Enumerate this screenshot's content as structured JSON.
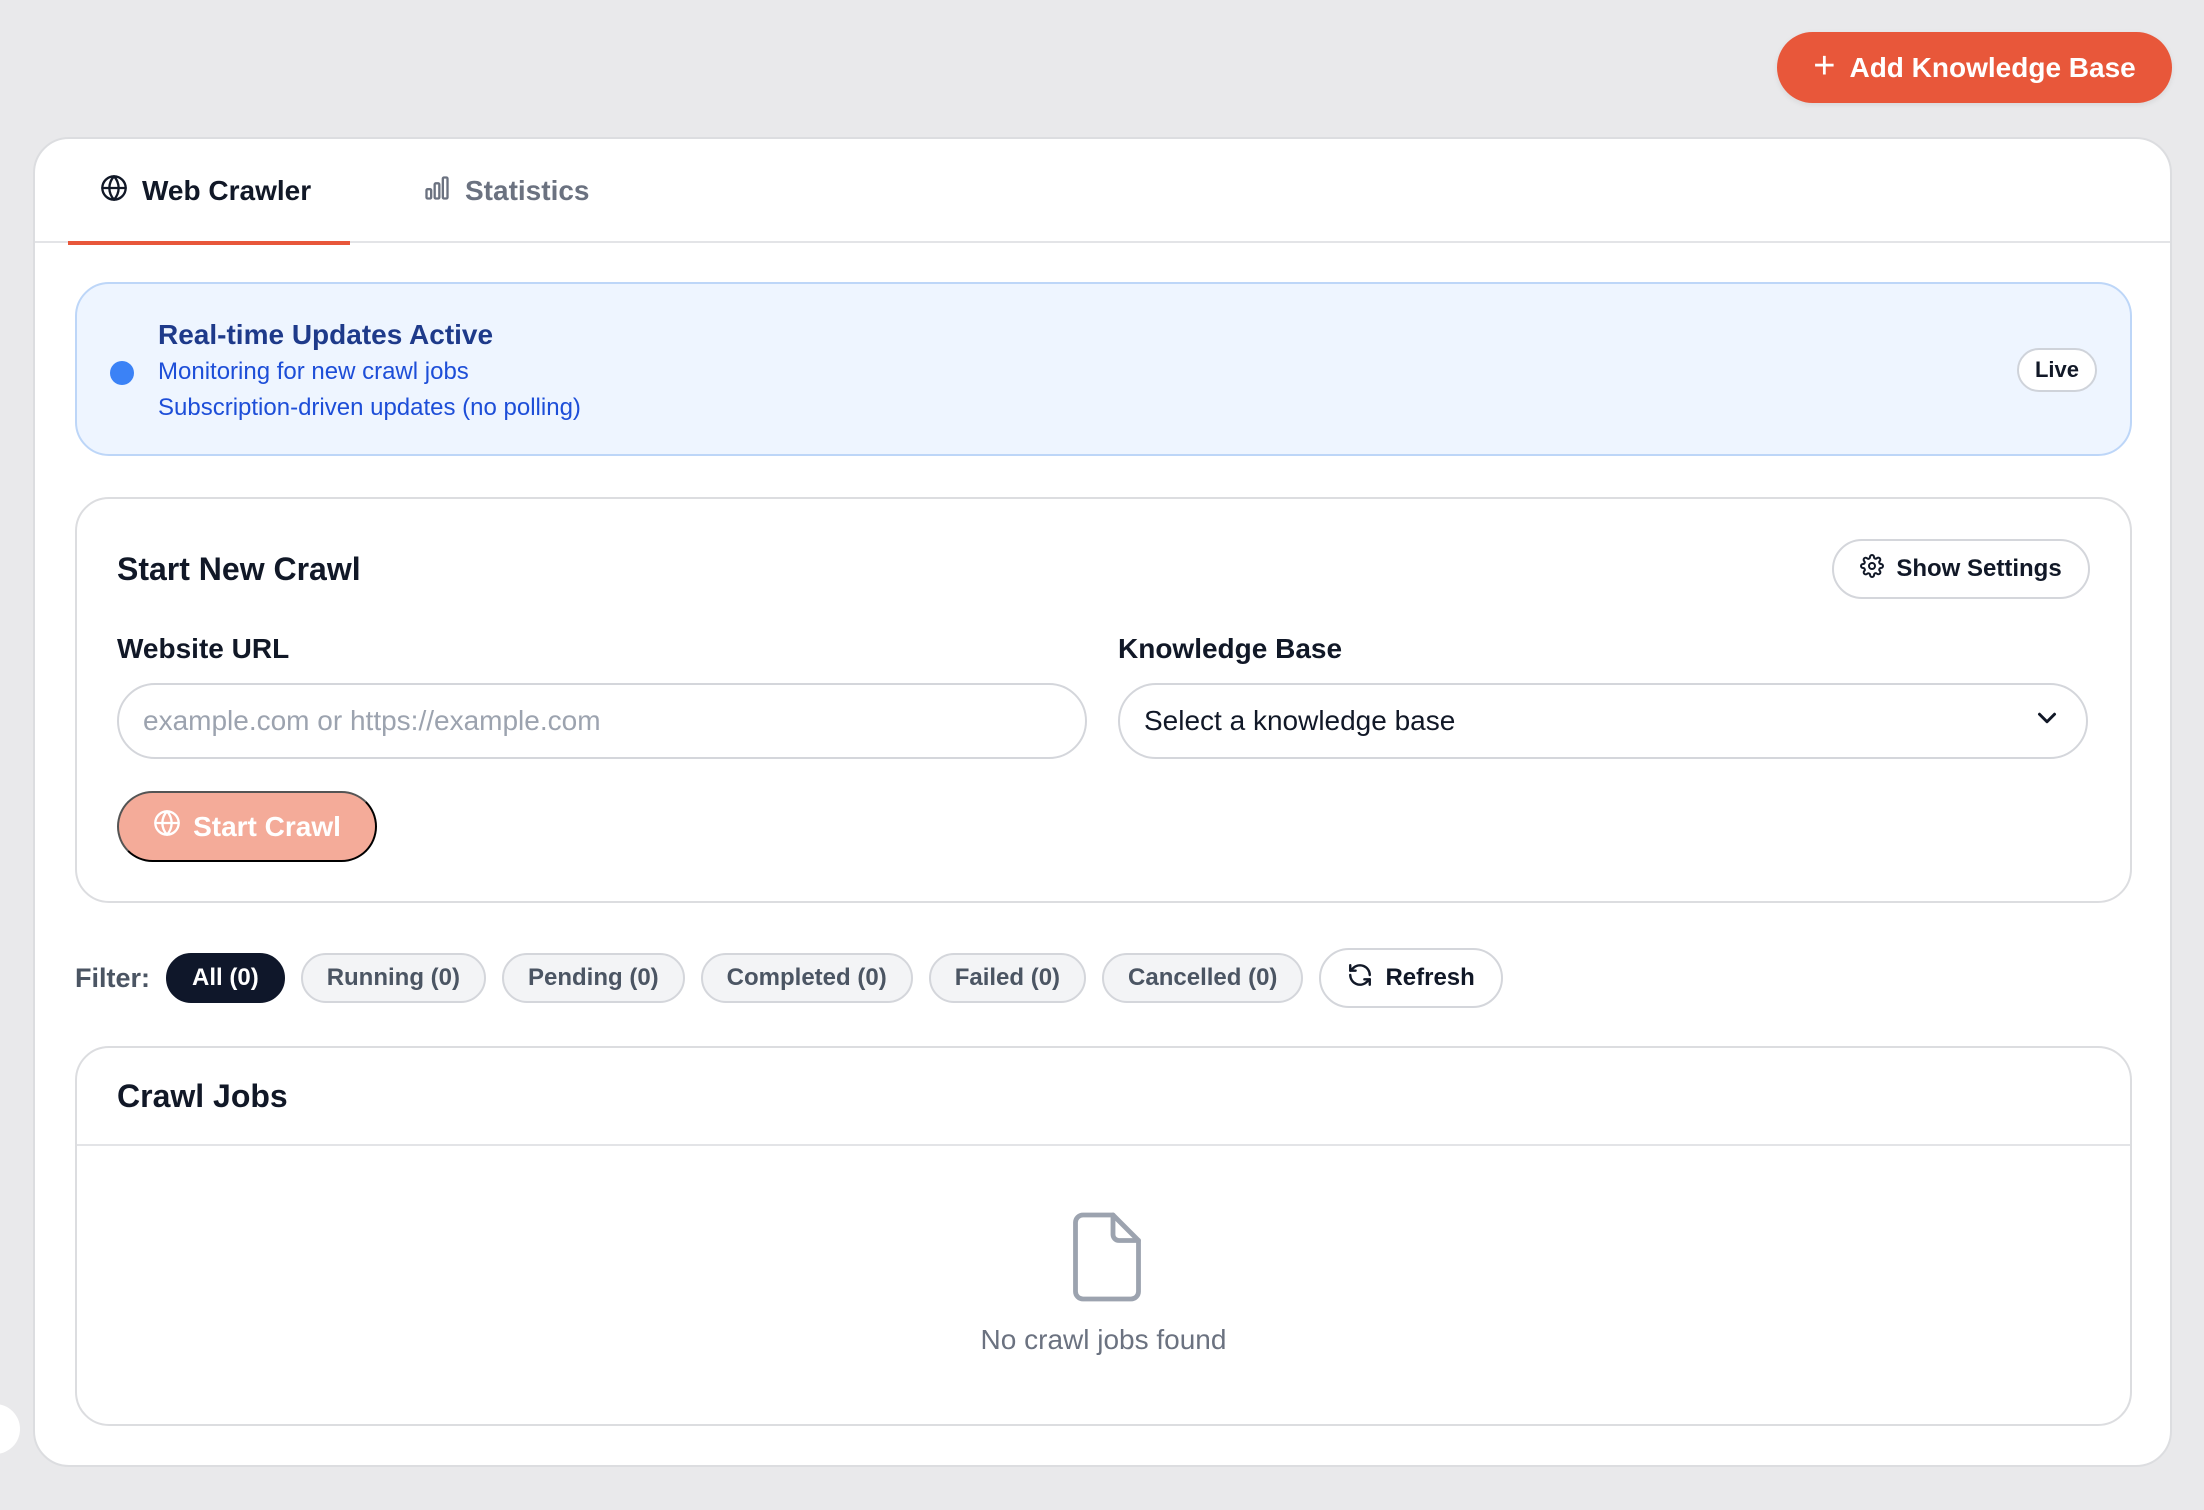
{
  "header": {
    "add_kb_label": "Add Knowledge Base"
  },
  "tabs": [
    {
      "label": "Web Crawler",
      "icon": "globe-icon",
      "active": true
    },
    {
      "label": "Statistics",
      "icon": "bar-chart-icon",
      "active": false
    }
  ],
  "banner": {
    "title": "Real-time Updates Active",
    "line1": "Monitoring for new crawl jobs",
    "line2": "Subscription-driven updates (no polling)",
    "badge": "Live"
  },
  "crawl_form": {
    "heading": "Start New Crawl",
    "settings_label": "Show Settings",
    "url_label": "Website URL",
    "url_placeholder": "example.com or https://example.com",
    "url_value": "",
    "kb_label": "Knowledge Base",
    "kb_selected": "Select a knowledge base",
    "start_label": "Start Crawl"
  },
  "filters": {
    "label": "Filter:",
    "items": [
      {
        "label": "All (0)",
        "active": true
      },
      {
        "label": "Running (0)",
        "active": false
      },
      {
        "label": "Pending (0)",
        "active": false
      },
      {
        "label": "Completed (0)",
        "active": false
      },
      {
        "label": "Failed (0)",
        "active": false
      },
      {
        "label": "Cancelled (0)",
        "active": false
      }
    ],
    "refresh_label": "Refresh"
  },
  "jobs": {
    "heading": "Crawl Jobs",
    "empty_text": "No crawl jobs found"
  },
  "colors": {
    "accent": "#e8573a",
    "accent_disabled": "#f4ab99",
    "info_bg": "#eef5ff",
    "info_text": "#1d4ed8",
    "dark": "#0f172a"
  }
}
